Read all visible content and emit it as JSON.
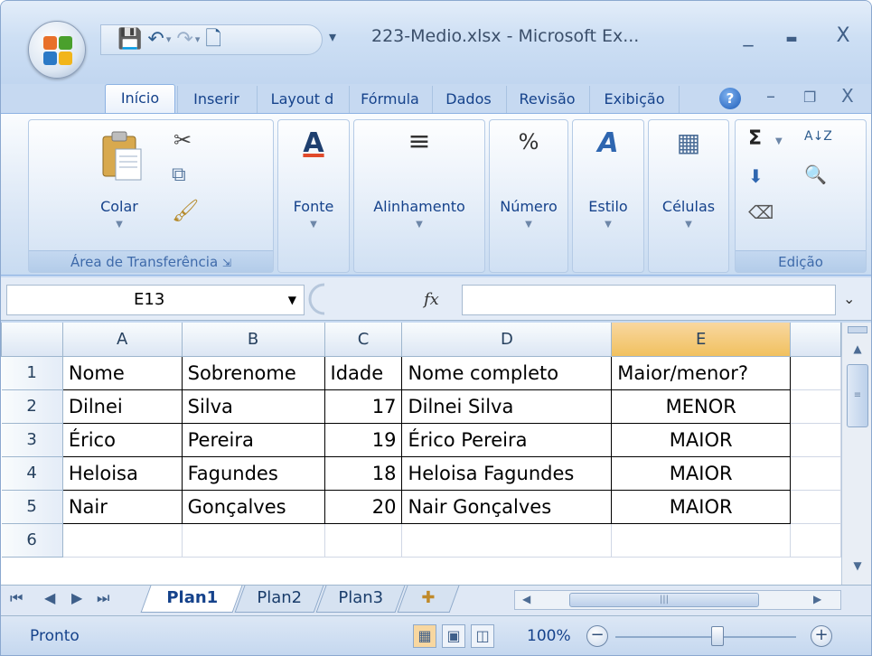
{
  "window": {
    "title": "223-Medio.xlsx - Microsoft Ex...",
    "controls": {
      "minimize": "_",
      "maximize": "▬",
      "close": "X"
    },
    "doc_controls": {
      "minimize": "–",
      "restore": "❐",
      "close": "X"
    }
  },
  "qat": {
    "save": "💾",
    "undo": "↶",
    "redo": "↷",
    "print_preview": "🗋",
    "more": "▾"
  },
  "tabs": [
    "Início",
    "Inserir",
    "Layout d",
    "Fórmula",
    "Dados",
    "Revisão",
    "Exibição"
  ],
  "active_tab": "Início",
  "help_icon": "?",
  "ribbon": {
    "clipboard": {
      "paste_label": "Colar",
      "footer": "Área de Transferência",
      "launcher": "⇲"
    },
    "font": {
      "label": "Fonte",
      "icon": "A"
    },
    "alignment": {
      "label": "Alinhamento",
      "icon": "≡"
    },
    "number": {
      "label": "Número",
      "icon": "%"
    },
    "style": {
      "label": "Estilo",
      "icon": "A"
    },
    "cells": {
      "label": "Células",
      "icon": "▦"
    },
    "editing": {
      "footer": "Edição",
      "sum_icon": "Σ",
      "sort_icon": "A↓Z",
      "fill_icon": "⬇",
      "find_icon": "🔍",
      "clear_icon": "⌫"
    }
  },
  "formula_bar": {
    "name_box": "E13",
    "fx": "fx",
    "value": "",
    "expand": "⌄"
  },
  "columns": [
    "A",
    "B",
    "C",
    "D",
    "E"
  ],
  "selected_column": "E",
  "rows": [
    {
      "num": "1",
      "cells": [
        "Nome",
        "Sobrenome",
        "Idade",
        "Nome completo",
        "Maior/menor?"
      ]
    },
    {
      "num": "2",
      "cells": [
        "Dilnei",
        "Silva",
        "17",
        "Dilnei Silva",
        "MENOR"
      ]
    },
    {
      "num": "3",
      "cells": [
        "Érico",
        "Pereira",
        "19",
        "Érico Pereira",
        "MAIOR"
      ]
    },
    {
      "num": "4",
      "cells": [
        "Heloisa",
        "Fagundes",
        "18",
        "Heloisa Fagundes",
        "MAIOR"
      ]
    },
    {
      "num": "5",
      "cells": [
        "Nair",
        "Gonçalves",
        "20",
        "Nair Gonçalves",
        "MAIOR"
      ]
    },
    {
      "num": "6",
      "cells": [
        "",
        "",
        "",
        "",
        ""
      ]
    }
  ],
  "sheets": [
    "Plan1",
    "Plan2",
    "Plan3"
  ],
  "active_sheet": "Plan1",
  "status": {
    "text": "Pronto",
    "zoom": "100%",
    "zoom_out": "−",
    "zoom_in": "+"
  }
}
